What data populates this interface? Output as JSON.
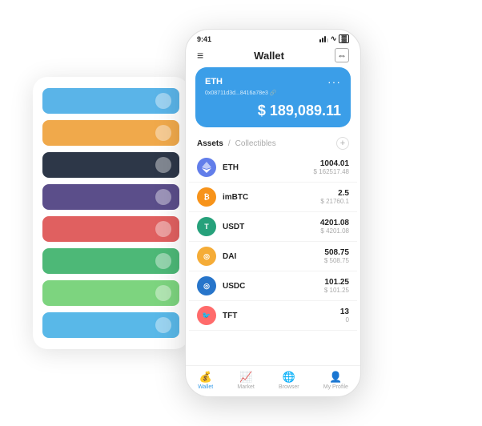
{
  "scene": {
    "bg_card": {
      "rows": [
        {
          "color": "row-blue"
        },
        {
          "color": "row-orange"
        },
        {
          "color": "row-dark"
        },
        {
          "color": "row-purple"
        },
        {
          "color": "row-red"
        },
        {
          "color": "row-green"
        },
        {
          "color": "row-light-green"
        },
        {
          "color": "row-sky"
        }
      ]
    },
    "phone": {
      "status_bar": {
        "time": "9:41",
        "signal": "▌▌▌",
        "wifi": "WiFi",
        "battery": "🔋"
      },
      "header": {
        "menu_icon": "≡",
        "title": "Wallet",
        "scan_icon": "⊡"
      },
      "eth_card": {
        "title": "ETH",
        "address": "0x08711d3d...8416a78e3 🔗",
        "dots": "···",
        "balance": "$ 189,089.11"
      },
      "assets_header": {
        "tab_active": "Assets",
        "separator": "/",
        "tab_inactive": "Collectibles",
        "add_icon": "+"
      },
      "assets": [
        {
          "symbol": "ETH",
          "icon_label": "◆",
          "icon_class": "icon-eth",
          "amount": "1004.01",
          "usd": "$ 162517.48"
        },
        {
          "symbol": "imBTC",
          "icon_label": "₿",
          "icon_class": "icon-imbtc",
          "amount": "2.5",
          "usd": "$ 21760.1"
        },
        {
          "symbol": "USDT",
          "icon_label": "T",
          "icon_class": "icon-usdt",
          "amount": "4201.08",
          "usd": "$ 4201.08"
        },
        {
          "symbol": "DAI",
          "icon_label": "D",
          "icon_class": "icon-dai",
          "amount": "508.75",
          "usd": "$ 508.75"
        },
        {
          "symbol": "USDC",
          "icon_label": "◎",
          "icon_class": "icon-usdc",
          "amount": "101.25",
          "usd": "$ 101.25"
        },
        {
          "symbol": "TFT",
          "icon_label": "🐦",
          "icon_class": "icon-tft",
          "amount": "13",
          "usd": "0"
        }
      ],
      "bottom_nav": [
        {
          "label": "Wallet",
          "icon": "💰",
          "active": true
        },
        {
          "label": "Market",
          "icon": "📊",
          "active": false
        },
        {
          "label": "Browser",
          "icon": "👤",
          "active": false
        },
        {
          "label": "My Profile",
          "icon": "👤",
          "active": false
        }
      ]
    }
  }
}
